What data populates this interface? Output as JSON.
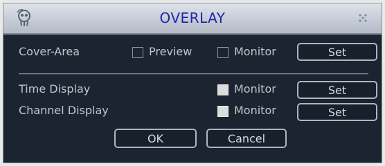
{
  "window": {
    "title": "OVERLAY",
    "icon": "skull-logo-icon",
    "close_icon": "close-icon"
  },
  "cover_area": {
    "label": "Cover-Area",
    "preview_label": "Preview",
    "preview_checked": false,
    "monitor_label": "Monitor",
    "monitor_checked": false,
    "set_label": "Set"
  },
  "time_display": {
    "label": "Time Display",
    "monitor_label": "Monitor",
    "monitor_checked": true,
    "set_label": "Set"
  },
  "channel_display": {
    "label": "Channel Display",
    "monitor_label": "Monitor",
    "monitor_checked": true,
    "set_label": "Set"
  },
  "footer": {
    "ok_label": "OK",
    "cancel_label": "Cancel"
  },
  "colors": {
    "background": "#1b2430",
    "title_text": "#2424a8",
    "label_text": "#c2c6cc",
    "button_border": "#aeb6c2"
  }
}
